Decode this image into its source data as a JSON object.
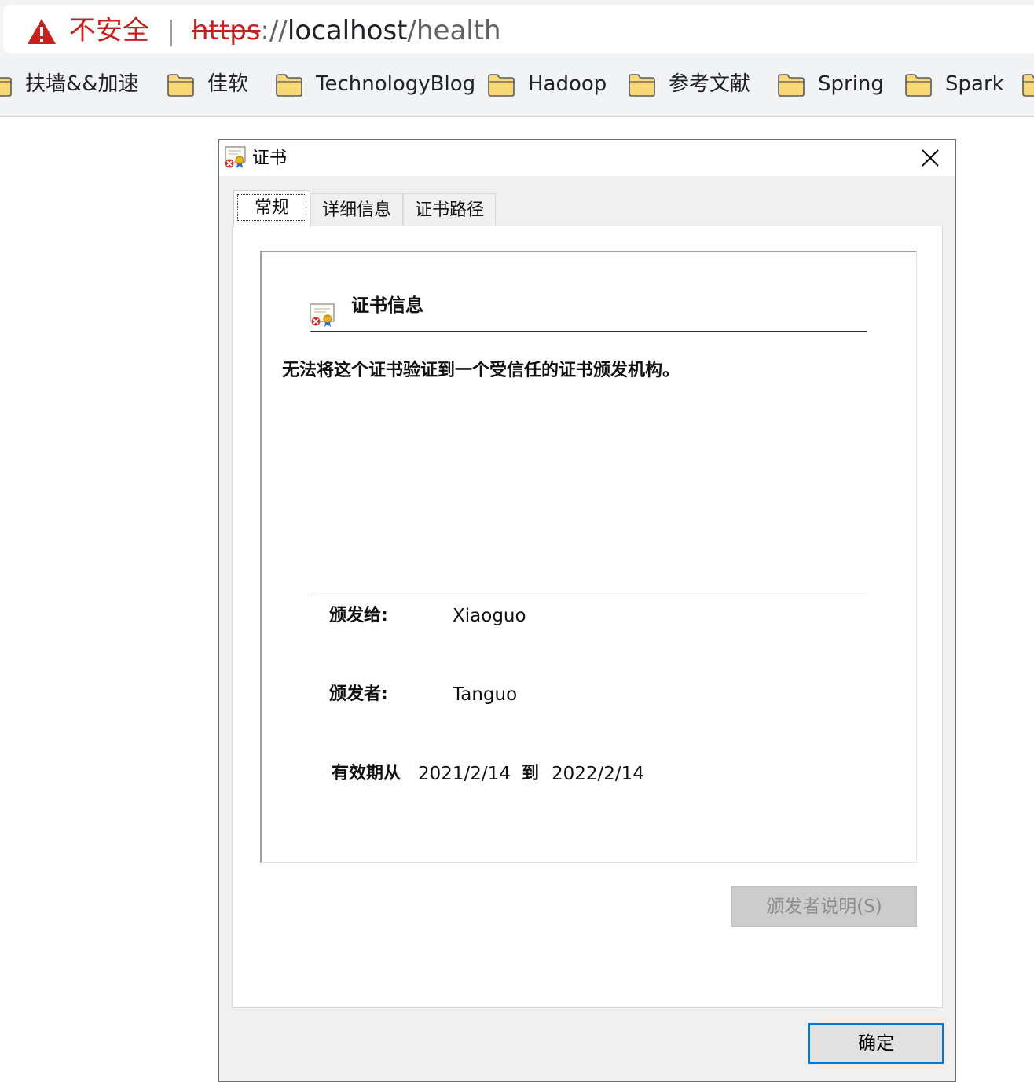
{
  "browser": {
    "security_label": "不安全",
    "url": {
      "scheme": "https",
      "separator": "://",
      "host": "localhost",
      "path": "/health"
    },
    "bookmarks": [
      {
        "label": "扶墙&&加速",
        "icon": "folder-icon"
      },
      {
        "label": "佳软",
        "icon": "folder-icon"
      },
      {
        "label": "TechnologyBlog",
        "icon": "folder-icon"
      },
      {
        "label": "Hadoop",
        "icon": "folder-icon"
      },
      {
        "label": "参考文献",
        "icon": "folder-icon"
      },
      {
        "label": "Spring",
        "icon": "folder-icon"
      },
      {
        "label": "Spark",
        "icon": "folder-icon"
      }
    ]
  },
  "dialog": {
    "title": "证书",
    "tabs": [
      "常规",
      "详细信息",
      "证书路径"
    ],
    "active_tab": "常规",
    "info_heading": "证书信息",
    "warning": "无法将这个证书验证到一个受信任的证书颁发机构。",
    "issued_to_label": "颁发给:",
    "issued_to": "Xiaoguo",
    "issued_by_label": "颁发者:",
    "issued_by": "Tanguo",
    "valid_from_label": "有效期从",
    "valid_from": "2021/2/14",
    "valid_to_label": "到",
    "valid_to": "2022/2/14",
    "issuer_statement_button": "颁发者说明(S)",
    "ok_button": "确定"
  },
  "colors": {
    "not_secure_red": "#c5221f",
    "folder_yellow": "#f8d775",
    "focus_blue": "#0078d7",
    "dialog_bg": "#f0f0f0"
  }
}
